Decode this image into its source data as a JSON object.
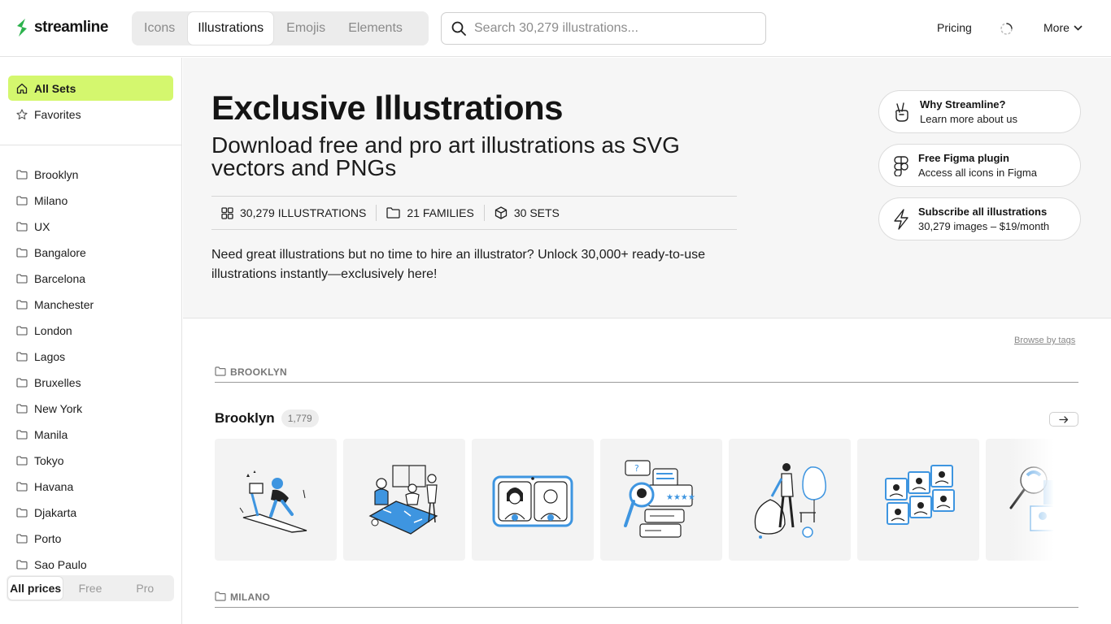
{
  "header": {
    "brand": "streamline",
    "tabs": [
      {
        "label": "Icons"
      },
      {
        "label": "Illustrations"
      },
      {
        "label": "Emojis"
      },
      {
        "label": "Elements"
      }
    ],
    "search_placeholder": "Search 30,279 illustrations...",
    "pricing": "Pricing",
    "more": "More"
  },
  "sidebar": {
    "top_items": [
      {
        "label": "All Sets",
        "icon": "home-icon"
      },
      {
        "label": "Favorites",
        "icon": "star-icon"
      }
    ],
    "families": [
      "Brooklyn",
      "Milano",
      "UX",
      "Bangalore",
      "Barcelona",
      "Manchester",
      "London",
      "Lagos",
      "Bruxelles",
      "New York",
      "Manila",
      "Tokyo",
      "Havana",
      "Djakarta",
      "Porto",
      "Sao Paulo"
    ],
    "price_filter": [
      "All prices",
      "Free",
      "Pro"
    ]
  },
  "hero": {
    "title": "Exclusive Illustrations",
    "subtitle": "Download free and pro art illustrations as SVG vectors and PNGs",
    "stats": [
      {
        "label": "30,279 ILLUSTRATIONS",
        "icon": "grid-icon"
      },
      {
        "label": "21 FAMILIES",
        "icon": "folder-icon"
      },
      {
        "label": "30 SETS",
        "icon": "cube-icon"
      }
    ],
    "description": "Need great illustrations but no time to hire an illustrator? Unlock 30,000+ ready-to-use illustrations instantly—exclusively here!",
    "cards": [
      {
        "title": "Why Streamline?",
        "subtitle": "Learn more about us",
        "icon": "peace-hand-icon"
      },
      {
        "title": "Free Figma plugin",
        "subtitle": "Access all icons in Figma",
        "icon": "figma-icon"
      },
      {
        "title": "Subscribe all illustrations",
        "subtitle": "30,279 images – $19/month",
        "icon": "lightning-icon"
      }
    ]
  },
  "main": {
    "browse_by_tags": "Browse by tags",
    "sections": [
      {
        "heading": "BROOKLYN",
        "set_name": "Brooklyn",
        "count": "1,779",
        "thumbnails": [
          "treadmill-illustration",
          "team-map-illustration",
          "video-call-illustration",
          "candidate-review-illustration",
          "garden-worker-illustration",
          "puzzle-team-illustration",
          "search-puzzle-illustration"
        ]
      },
      {
        "heading": "MILANO"
      }
    ]
  },
  "colors": {
    "accent": "#d4f76e",
    "illustration_blue": "#3e95e0",
    "brand_green": "#2bb24c"
  }
}
